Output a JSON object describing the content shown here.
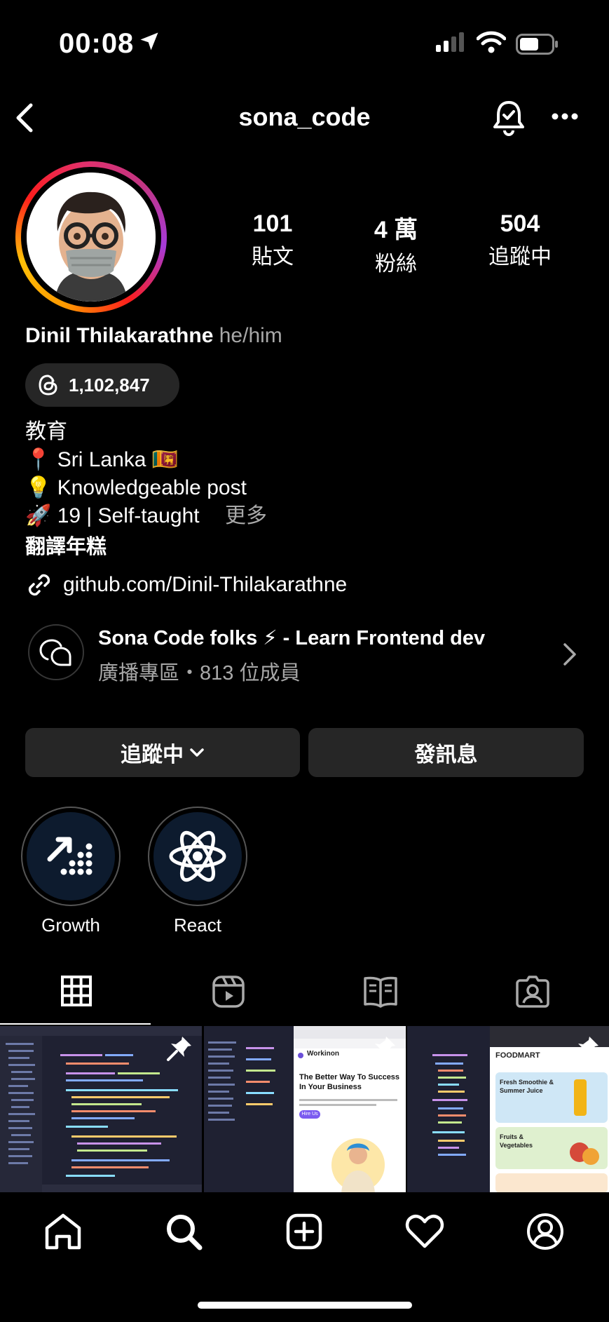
{
  "status_bar": {
    "time": "00:08"
  },
  "header": {
    "username": "sona_code"
  },
  "stats": {
    "posts": {
      "value": "101",
      "label": "貼文"
    },
    "followers": {
      "value": "4 萬",
      "label": "粉絲"
    },
    "following": {
      "value": "504",
      "label": "追蹤中"
    }
  },
  "profile": {
    "name": "Dinil Thilakarathne",
    "pronouns": "he/him",
    "threads_count": "1,102,847",
    "category": "教育",
    "bio": [
      {
        "emoji": "📍",
        "text": "Sri Lanka 🇱🇰"
      },
      {
        "emoji": "💡",
        "text": "Knowledgeable post"
      },
      {
        "emoji": "🚀",
        "text": "19 | Self-taught"
      }
    ],
    "more": "更多",
    "translate": "翻譯年糕",
    "link": "github.com/Dinil-Thilakarathne"
  },
  "channel": {
    "title": "Sona Code folks ⚡ - Learn Frontend dev",
    "subtitle": "廣播專區・813 位成員"
  },
  "actions": {
    "following": "追蹤中",
    "message": "發訊息"
  },
  "highlights": [
    {
      "label": "Growth",
      "icon": "growth-icon"
    },
    {
      "label": "React",
      "icon": "react-atom-icon"
    }
  ],
  "tabs": [
    "grid-icon",
    "reels-icon",
    "guides-icon",
    "tagged-icon"
  ],
  "posts": {
    "post2": {
      "brand": "Workinon",
      "headline": "The Better Way To Success In Your Business",
      "cta": "Hire Us"
    },
    "post3": {
      "brand": "FOODMART",
      "item1": "Fresh Smoothie & Summer Juice",
      "item2": "Fruits & Vegetables"
    }
  },
  "colors": {
    "background": "#000000",
    "button": "#262626",
    "secondary_text": "#a8a8a8"
  }
}
